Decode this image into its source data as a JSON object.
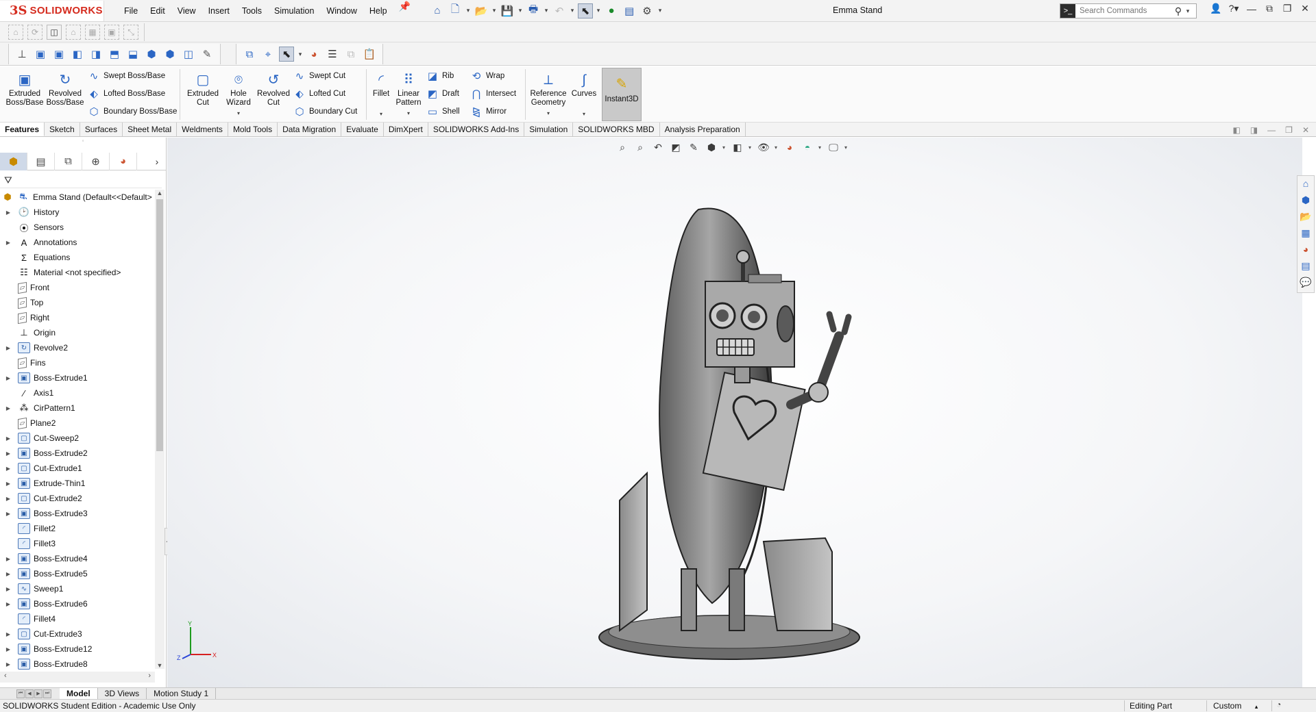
{
  "app": {
    "brand_mark": "3S",
    "brand": "SOLIDWORKS",
    "doc_title": "Emma Stand"
  },
  "menu": [
    "File",
    "Edit",
    "View",
    "Insert",
    "Tools",
    "Simulation",
    "Window",
    "Help"
  ],
  "search": {
    "placeholder": "Search Commands"
  },
  "features": {
    "extruded_boss": "Extruded Boss/Base",
    "revolved_boss": "Revolved Boss/Base",
    "swept_boss": "Swept Boss/Base",
    "lofted_boss": "Lofted Boss/Base",
    "boundary_boss": "Boundary Boss/Base",
    "extruded_cut": "Extruded Cut",
    "hole_wizard": "Hole Wizard",
    "revolved_cut": "Revolved Cut",
    "swept_cut": "Swept Cut",
    "lofted_cut": "Lofted Cut",
    "boundary_cut": "Boundary Cut",
    "fillet": "Fillet",
    "linear_pattern": "Linear Pattern",
    "rib": "Rib",
    "draft": "Draft",
    "shell": "Shell",
    "wrap": "Wrap",
    "intersect": "Intersect",
    "mirror": "Mirror",
    "reference_geometry": "Reference Geometry",
    "curves": "Curves",
    "instant3d": "Instant3D"
  },
  "tabs": [
    "Features",
    "Sketch",
    "Surfaces",
    "Sheet Metal",
    "Weldments",
    "Mold Tools",
    "Data Migration",
    "Evaluate",
    "DimXpert",
    "SOLIDWORKS Add-Ins",
    "Simulation",
    "SOLIDWORKS MBD",
    "Analysis Preparation"
  ],
  "active_tab": "Features",
  "tree": {
    "root": "Emma Stand  (Default<<Default>",
    "items": [
      {
        "label": "History",
        "icon": "history-icon",
        "expandable": true
      },
      {
        "label": "Sensors",
        "icon": "sensors-icon",
        "expandable": false
      },
      {
        "label": "Annotations",
        "icon": "annotations-icon",
        "expandable": true
      },
      {
        "label": "Equations",
        "icon": "equations-icon",
        "expandable": false
      },
      {
        "label": "Material <not specified>",
        "icon": "material-icon",
        "expandable": false
      },
      {
        "label": "Front",
        "icon": "plane-icon",
        "expandable": false
      },
      {
        "label": "Top",
        "icon": "plane-icon",
        "expandable": false
      },
      {
        "label": "Right",
        "icon": "plane-icon",
        "expandable": false
      },
      {
        "label": "Origin",
        "icon": "origin-icon",
        "expandable": false
      },
      {
        "label": "Revolve2",
        "icon": "revolve-icon",
        "expandable": true
      },
      {
        "label": "Fins",
        "icon": "plane-icon",
        "expandable": false
      },
      {
        "label": "Boss-Extrude1",
        "icon": "extrude-icon",
        "expandable": true
      },
      {
        "label": "Axis1",
        "icon": "axis-icon",
        "expandable": false
      },
      {
        "label": "CirPattern1",
        "icon": "pattern-icon",
        "expandable": true
      },
      {
        "label": "Plane2",
        "icon": "plane-icon",
        "expandable": false
      },
      {
        "label": "Cut-Sweep2",
        "icon": "cut-icon",
        "expandable": true
      },
      {
        "label": "Boss-Extrude2",
        "icon": "extrude-icon",
        "expandable": true
      },
      {
        "label": "Cut-Extrude1",
        "icon": "cut-icon",
        "expandable": true
      },
      {
        "label": "Extrude-Thin1",
        "icon": "extrude-icon",
        "expandable": true
      },
      {
        "label": "Cut-Extrude2",
        "icon": "cut-icon",
        "expandable": true
      },
      {
        "label": "Boss-Extrude3",
        "icon": "extrude-icon",
        "expandable": true
      },
      {
        "label": "Fillet2",
        "icon": "fillet-icon",
        "expandable": false
      },
      {
        "label": "Fillet3",
        "icon": "fillet-icon",
        "expandable": false
      },
      {
        "label": "Boss-Extrude4",
        "icon": "extrude-icon",
        "expandable": true
      },
      {
        "label": "Boss-Extrude5",
        "icon": "extrude-icon",
        "expandable": true
      },
      {
        "label": "Sweep1",
        "icon": "sweep-icon",
        "expandable": true
      },
      {
        "label": "Boss-Extrude6",
        "icon": "extrude-icon",
        "expandable": true
      },
      {
        "label": "Fillet4",
        "icon": "fillet-icon",
        "expandable": false
      },
      {
        "label": "Cut-Extrude3",
        "icon": "cut-icon",
        "expandable": true
      },
      {
        "label": "Boss-Extrude12",
        "icon": "extrude-icon",
        "expandable": true
      },
      {
        "label": "Boss-Extrude8",
        "icon": "extrude-icon",
        "expandable": true
      }
    ]
  },
  "bottom_tabs": [
    "Model",
    "3D Views",
    "Motion Study 1"
  ],
  "active_bottom_tab": "Model",
  "status": {
    "left": "SOLIDWORKS Student Edition - Academic Use Only",
    "mode": "Editing Part",
    "units": "Custom"
  },
  "triad": {
    "y": "Y",
    "x": "X",
    "z": "Z"
  },
  "colors": {
    "brand_red": "#d52b1e",
    "accent_blue": "#2b66c4"
  }
}
